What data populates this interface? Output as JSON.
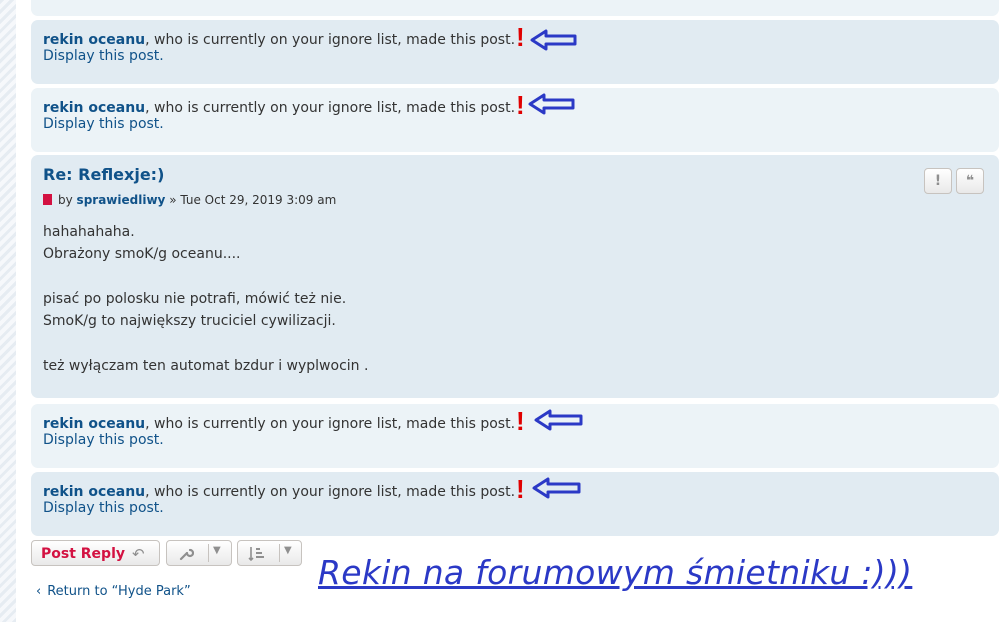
{
  "ignored_posts": [
    {
      "username": "rekin oceanu",
      "message": ", who is currently on your ignore list, made this post.",
      "display_link": "Display this post."
    },
    {
      "username": "rekin oceanu",
      "message": ", who is currently on your ignore list, made this post.",
      "display_link": "Display this post."
    },
    {
      "username": "rekin oceanu",
      "message": ", who is currently on your ignore list, made this post.",
      "display_link": "Display this post."
    },
    {
      "username": "rekin oceanu",
      "message": ", who is currently on your ignore list, made this post.",
      "display_link": "Display this post."
    }
  ],
  "post": {
    "title": "Re: Reflexje:)",
    "by": "by",
    "author": "sprawiedliwy",
    "date": "» Tue Oct 29, 2019 3:09 am",
    "lines": [
      "hahahahaha.",
      "Obrażony smoK/g oceanu....",
      "pisać po polosku nie potrafi, mówić też nie.",
      "SmoK/g to największy truciciel cywilizacji.",
      "też wyłączam ten automat bzdur i wyplwocin ."
    ],
    "report_button": "!",
    "quote_button": "❝"
  },
  "actions": {
    "post_reply": "Post Reply"
  },
  "annotation": "Rekin na forumowym śmietniku :)))",
  "return_link": "Return to “Hyde Park”",
  "colors": {
    "arrow": "#2b39c6",
    "exclamation": "#e00000",
    "link": "#105289",
    "reply": "#d31141"
  }
}
